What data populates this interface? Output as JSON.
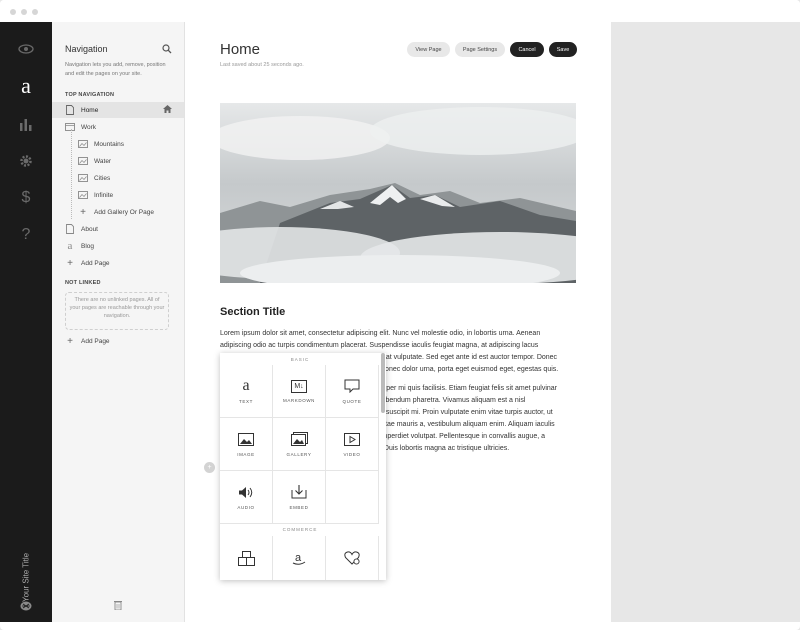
{
  "rail": {
    "icons": [
      "eye-icon",
      "site-logo-a",
      "analytics-icon",
      "settings-gear-icon",
      "commerce-dollar-icon",
      "help-icon",
      "user-avatar-icon"
    ],
    "logo_letter": "a",
    "site_title": "Your Site Title"
  },
  "nav": {
    "heading": "Navigation",
    "description": "Navigation lets you add, remove, position and edit the pages on your site.",
    "top_label": "TOP NAVIGATION",
    "items": [
      {
        "label": "Home",
        "icon": "page-icon"
      },
      {
        "label": "Work",
        "icon": "folder-icon"
      },
      {
        "label": "Mountains",
        "icon": "gallery-icon"
      },
      {
        "label": "Water",
        "icon": "gallery-icon"
      },
      {
        "label": "Cities",
        "icon": "gallery-icon"
      },
      {
        "label": "Infinite",
        "icon": "gallery-icon"
      },
      {
        "label": "Add Gallery Or Page",
        "icon": "plus-icon"
      },
      {
        "label": "About",
        "icon": "page-icon"
      },
      {
        "label": "Blog",
        "icon": "blog-icon"
      },
      {
        "label": "Add Page",
        "icon": "plus-icon"
      }
    ],
    "not_linked_label": "NOT LINKED",
    "unlinked_text": "There are no unlinked pages. All of your pages are reachable through your navigation.",
    "add_page_2": "Add Page"
  },
  "page": {
    "title": "Home",
    "saved": "Last saved about 25 seconds ago.",
    "buttons": {
      "view": "View Page",
      "settings": "Page Settings",
      "cancel": "Cancel",
      "save": "Save"
    },
    "section_title": "Section Title",
    "para1": [
      "Lorem ipsum dolor sit amet, consectetur adipiscing elit. Nunc vel molestie odio, in lobortis urna. Aenean",
      "adipiscing odio ac turpis condimentum placerat. Suspendisse iaculis feugiat magna, at adipiscing lacus",
      "tpat vulputate. Sed eget ante id est auctor tempor. Donec",
      "Donec dolor urna, porta eget euismod eget, egestas quis."
    ],
    "para2": [
      "orper mi quis facilisis. Etiam feugiat felis sit amet pulvinar",
      "bibendum pharetra. Vivamus aliquam est a nisl",
      "a suscipit mi. Proin vulputate enim vitae turpis auctor, ut",
      "vitae mauris a, vestibulum aliquam enim. Aliquam iaculis",
      "imperdiet volutpat. Pellentesque in convallis augue, a",
      ". Duis lobortis magna ac tristique ultricies."
    ]
  },
  "blocks": {
    "basic": "BASIC",
    "commerce": "COMMERCE",
    "tiles": [
      {
        "label": "TEXT",
        "glyph": "a"
      },
      {
        "label": "MARKDOWN",
        "glyph": "M↓"
      },
      {
        "label": "QUOTE",
        "glyph": "▭"
      },
      {
        "label": "IMAGE",
        "glyph": "▨"
      },
      {
        "label": "GALLERY",
        "glyph": "▨"
      },
      {
        "label": "VIDEO",
        "glyph": "▷"
      },
      {
        "label": "AUDIO",
        "glyph": "◁)"
      },
      {
        "label": "EMBED",
        "glyph": "⤓"
      }
    ],
    "commerce_glyphs": [
      "▣",
      "a",
      "♡"
    ]
  }
}
